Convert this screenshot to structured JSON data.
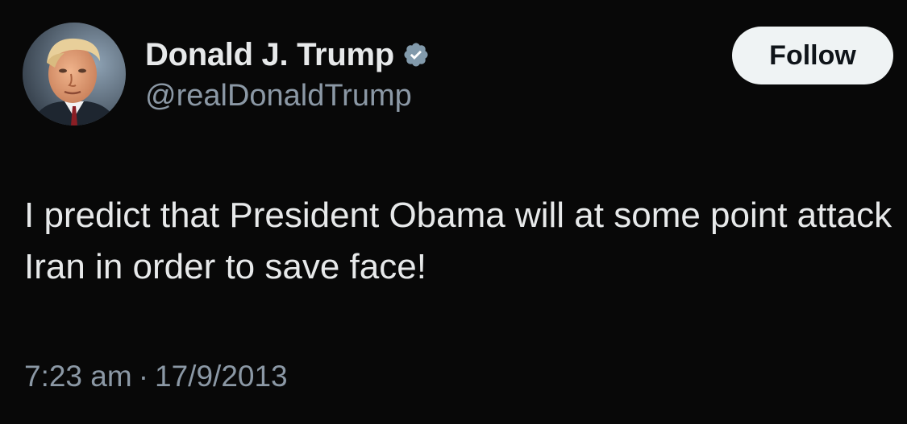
{
  "tweet": {
    "author": {
      "display_name": "Donald J. Trump",
      "handle": "@realDonaldTrump",
      "verified": true,
      "verified_icon": "verified-badge-icon",
      "verified_color": "#829aab",
      "avatar": "profile-photo"
    },
    "follow_label": "Follow",
    "text": "I predict that President Obama will at some point attack Iran in order to save face!",
    "time": "7:23 am",
    "separator": "·",
    "date": "17/9/2013"
  },
  "colors": {
    "background": "#080808",
    "primary_text": "#e7e9ea",
    "secondary_text": "#8b98a5",
    "button_bg": "#eff3f4",
    "button_text": "#0f1419"
  }
}
